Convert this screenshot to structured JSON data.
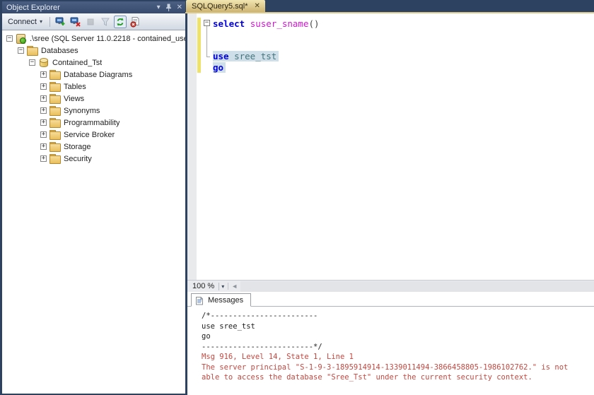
{
  "object_explorer": {
    "title": "Object Explorer",
    "connect_label": "Connect",
    "toolbar_icons": [
      "connect-server-icon",
      "disconnect-server-icon",
      "stop-icon",
      "filter-icon",
      "refresh-icon",
      "script-error-icon"
    ],
    "tree": [
      {
        "label": ".\\sree (SQL Server 11.0.2218 - contained_use",
        "level": 0,
        "toggle": "minus",
        "icon": "server"
      },
      {
        "label": "Databases",
        "level": 1,
        "toggle": "minus",
        "icon": "folder"
      },
      {
        "label": "Contained_Tst",
        "level": 2,
        "toggle": "minus",
        "icon": "database"
      },
      {
        "label": "Database Diagrams",
        "level": 3,
        "toggle": "plus",
        "icon": "folder"
      },
      {
        "label": "Tables",
        "level": 3,
        "toggle": "plus",
        "icon": "folder"
      },
      {
        "label": "Views",
        "level": 3,
        "toggle": "plus",
        "icon": "folder"
      },
      {
        "label": "Synonyms",
        "level": 3,
        "toggle": "plus",
        "icon": "folder"
      },
      {
        "label": "Programmability",
        "level": 3,
        "toggle": "plus",
        "icon": "folder"
      },
      {
        "label": "Service Broker",
        "level": 3,
        "toggle": "plus",
        "icon": "folder"
      },
      {
        "label": "Storage",
        "level": 3,
        "toggle": "plus",
        "icon": "folder"
      },
      {
        "label": "Security",
        "level": 3,
        "toggle": "plus",
        "icon": "folder"
      }
    ]
  },
  "document": {
    "tab_label": "SQLQuery5.sql*",
    "zoom_level": "100 %",
    "code_lines": [
      {
        "tokens": [
          {
            "t": "select",
            "c": "kw"
          },
          {
            "t": " ",
            "c": "pl"
          },
          {
            "t": "suser_sname",
            "c": "fn"
          },
          {
            "t": "()",
            "c": "pl"
          }
        ],
        "outline": "minus",
        "selected": false
      },
      {
        "tokens": [],
        "selected": false
      },
      {
        "tokens": [],
        "selected": false
      },
      {
        "tokens": [
          {
            "t": "use",
            "c": "kw"
          },
          {
            "t": " ",
            "c": "pl"
          },
          {
            "t": "sree_tst",
            "c": "id"
          }
        ],
        "selected": true
      },
      {
        "tokens": [
          {
            "t": "go",
            "c": "kw"
          }
        ],
        "selected": true
      }
    ]
  },
  "results": {
    "tab_label": "Messages",
    "lines": [
      {
        "text": "/*------------------------",
        "color": "black"
      },
      {
        "text": "use sree_tst",
        "color": "black"
      },
      {
        "text": "go",
        "color": "black"
      },
      {
        "text": "-------------------------*/",
        "color": "black"
      },
      {
        "text": "Msg 916, Level 14, State 1, Line 1",
        "color": "red"
      },
      {
        "text": "The server principal \"S-1-9-3-1895914914-1339011494-3866458805-1986102762.\" is not",
        "color": "red"
      },
      {
        "text": "able to access the database \"Sree_Tst\" under the current security context.",
        "color": "red"
      }
    ]
  },
  "colors": {
    "window_background": "#2d4160",
    "active_tab_gold": "#ccb473",
    "change_bar_yellow": "#eee26b",
    "selection_highlight": "#cfdfe9",
    "keyword_blue": "#0000e2",
    "function_magenta": "#d414d4",
    "error_red": "#c7473f"
  }
}
